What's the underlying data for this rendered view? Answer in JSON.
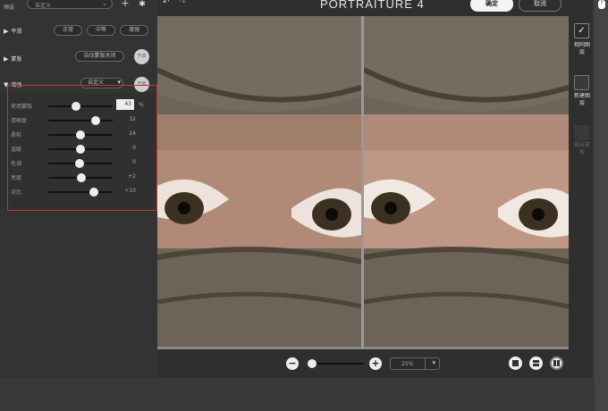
{
  "topbar": {
    "preset_label": "预设",
    "preset_value": "自定义",
    "add": "+",
    "gear": "✱"
  },
  "sections": {
    "smooth": {
      "label": "平滑",
      "buttons": [
        "正常",
        "中等",
        "增强"
      ]
    },
    "mask": {
      "label": "蒙版",
      "auto_btn": "自动蒙版关闭",
      "circle": "开启"
    },
    "enhance": {
      "label": "增强",
      "select": "自定义",
      "circle": "开启"
    }
  },
  "sliders": [
    {
      "name": "使用蒙版",
      "value": "43",
      "level": 0.43
    },
    {
      "name": "清晰度",
      "value": "32",
      "level": 0.74
    },
    {
      "name": "柔软",
      "value": "24",
      "level": 0.5
    },
    {
      "name": "温暖",
      "value": "0",
      "level": 0.5
    },
    {
      "name": "色调",
      "value": "0",
      "level": 0.48
    },
    {
      "name": "亮度",
      "value": "+2",
      "level": 0.51
    },
    {
      "name": "对比",
      "value": "+10",
      "level": 0.71
    }
  ],
  "pct": "%",
  "header": {
    "brand": "PORTRAITURE 4",
    "confirm": "确定",
    "cancel": "取消",
    "undo": "↶",
    "redo": "↷"
  },
  "zoom": {
    "minus": "−",
    "plus": "+",
    "value": "25%",
    "chev": "▾"
  },
  "right_panel": {
    "check": "✓",
    "item1": "相同图层",
    "item2": "新建图层",
    "item3": "输出蒙板"
  },
  "scroll_btn": "?",
  "colors": {
    "highlight_box": "#c0392b",
    "accent": "#eeeeee"
  }
}
